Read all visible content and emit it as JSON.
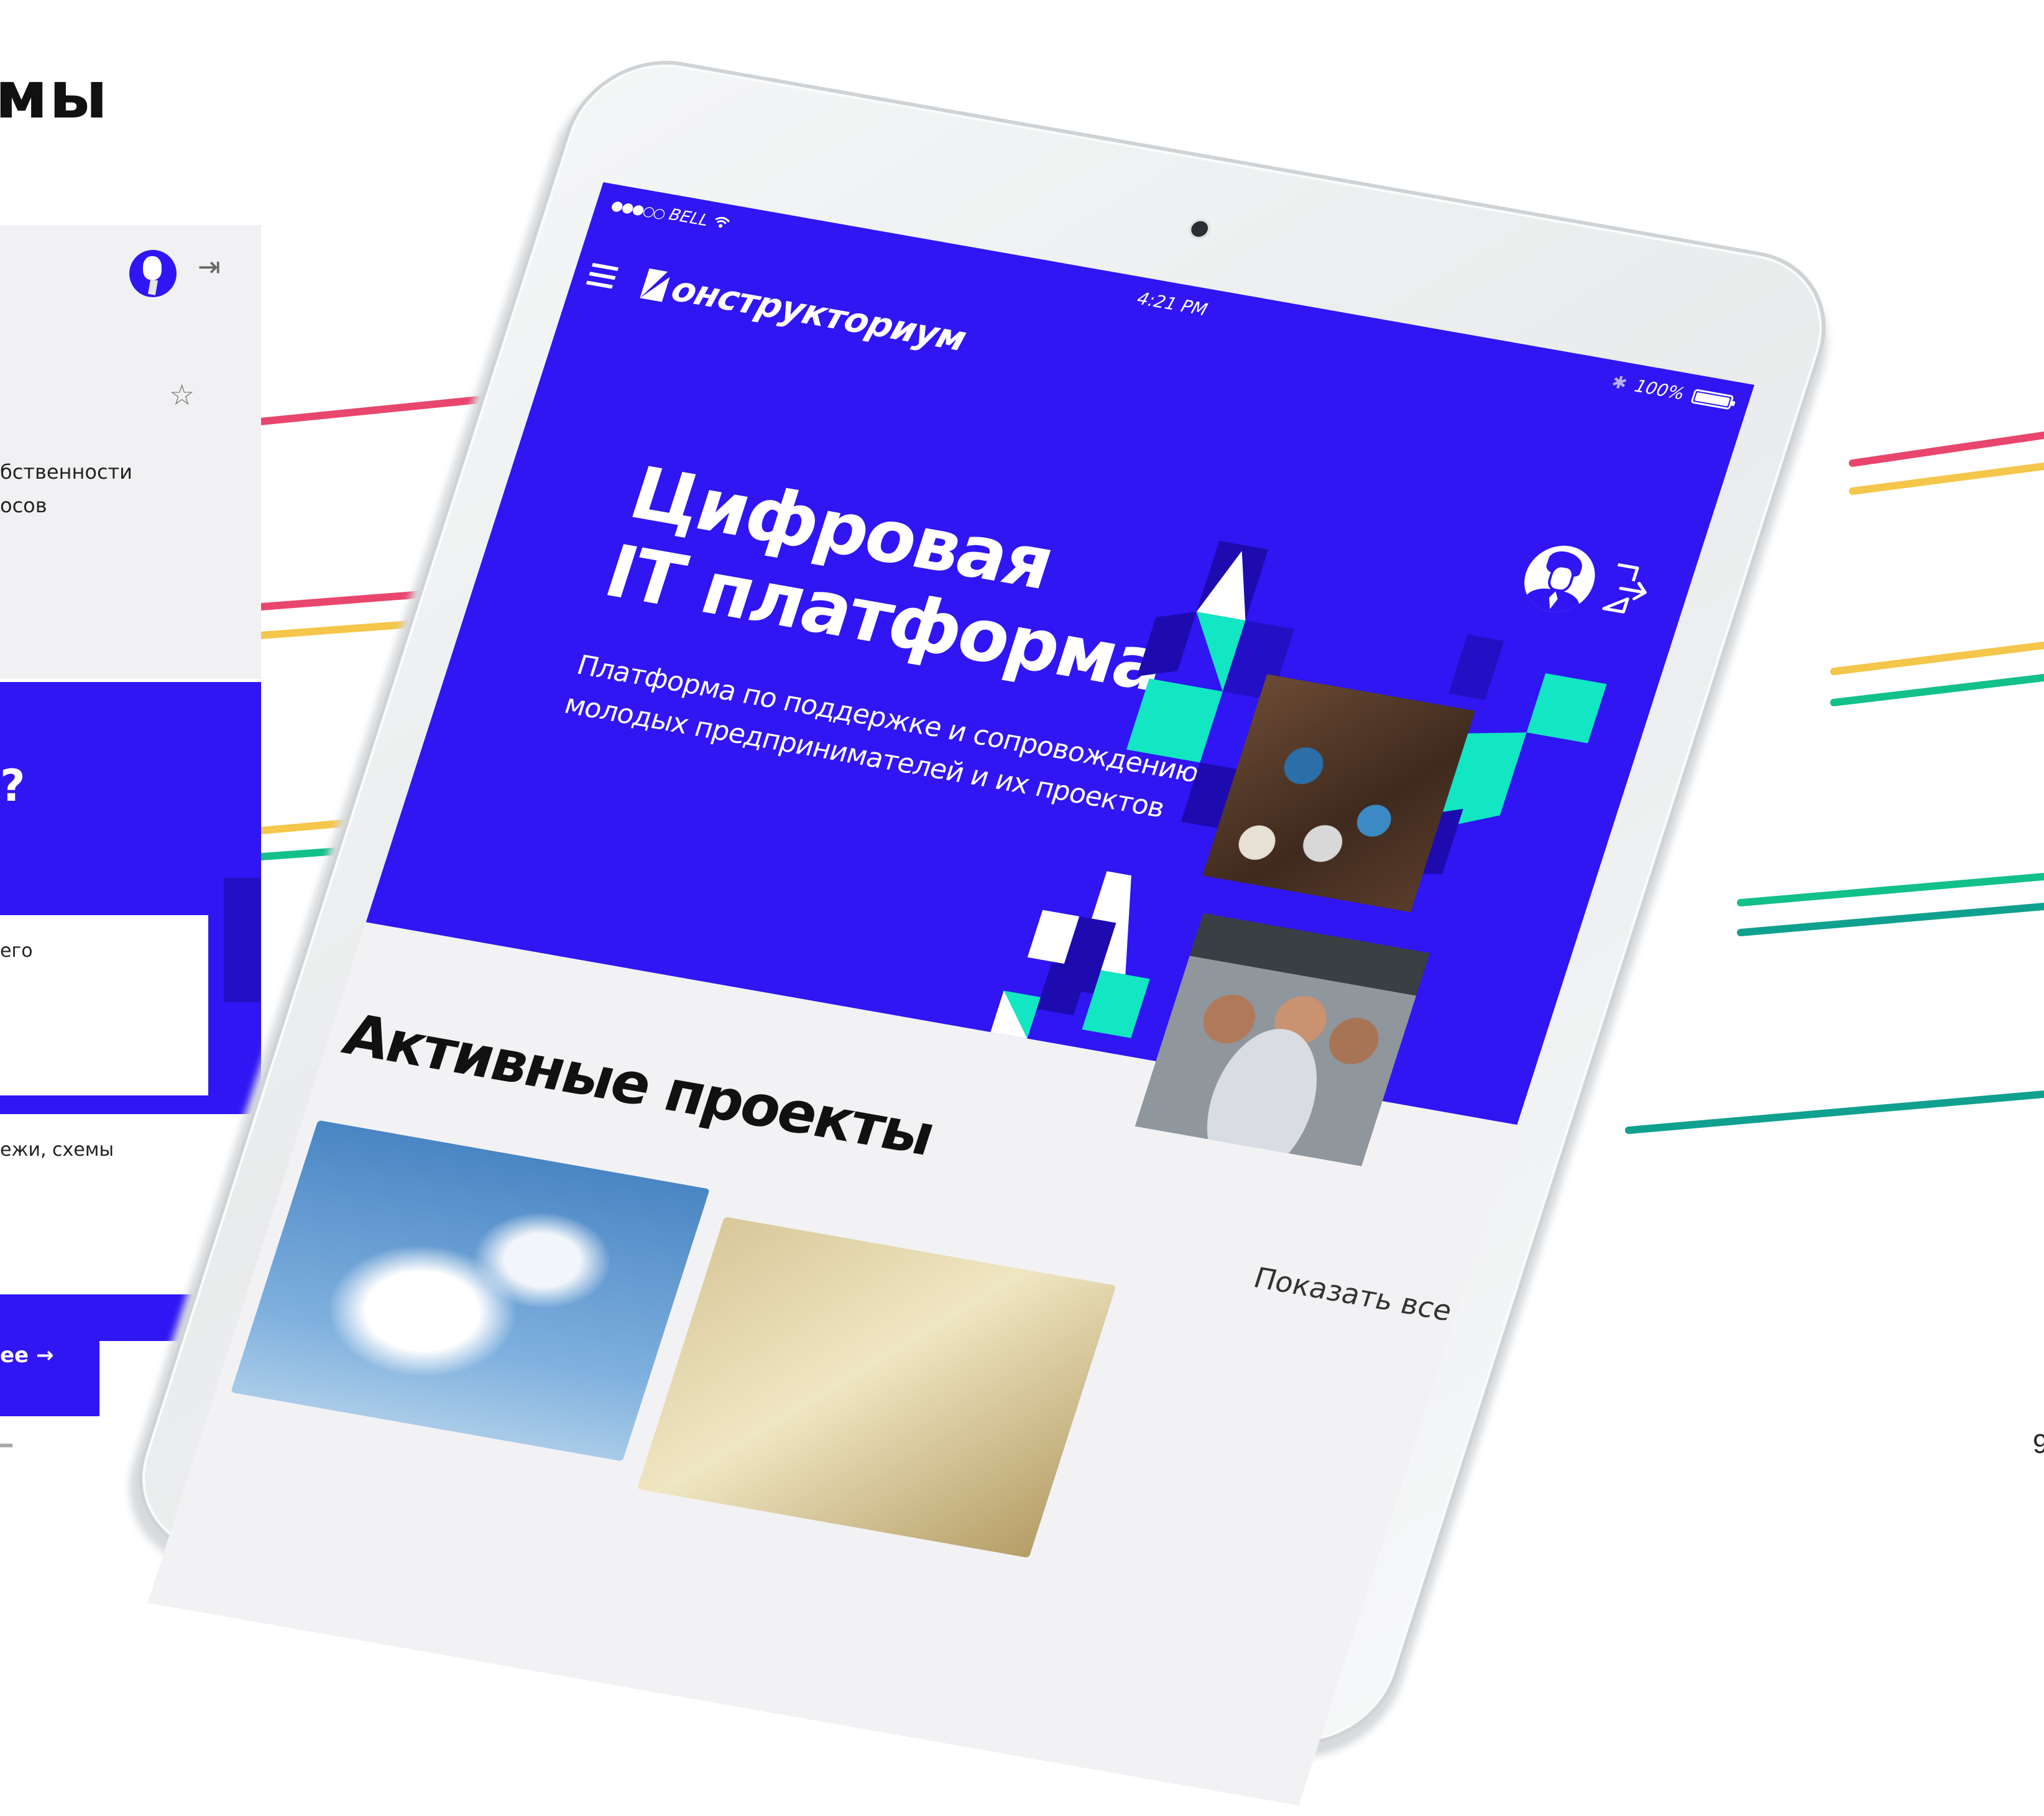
{
  "slide": {
    "title_fragment": "мы",
    "page_number": "9"
  },
  "colors": {
    "brand_blue": "#2f16f2",
    "accent_mint": "#12e6c2",
    "line_red": "#e8466e",
    "line_yellow": "#f4c64a",
    "line_green": "#12c08a",
    "line_teal": "#10a090"
  },
  "left_app": {
    "logout_icon": "logout-icon",
    "star_icon": "star-icon",
    "text_line_1": "бственности",
    "text_line_2": "осов",
    "question_mark": "?",
    "card_text": "его",
    "text_line_3": "ежи, схемы",
    "button_text": "ее →"
  },
  "tablet": {
    "status_bar": {
      "signal": "●●●○○",
      "carrier": "BELL",
      "time": "4:21 PM",
      "battery": "100%"
    },
    "header": {
      "menu_icon": "hamburger-menu-icon",
      "logo_text": "онструкториум"
    },
    "hero": {
      "title_lines": [
        "Цифровая",
        "IT платформа"
      ],
      "subtitle_lines": [
        "Платформа по поддержке и сопровождению",
        "молодых предпринимателей и их проектов"
      ]
    },
    "section": {
      "title": "Активные проекты",
      "show_all": "Показать все"
    }
  }
}
